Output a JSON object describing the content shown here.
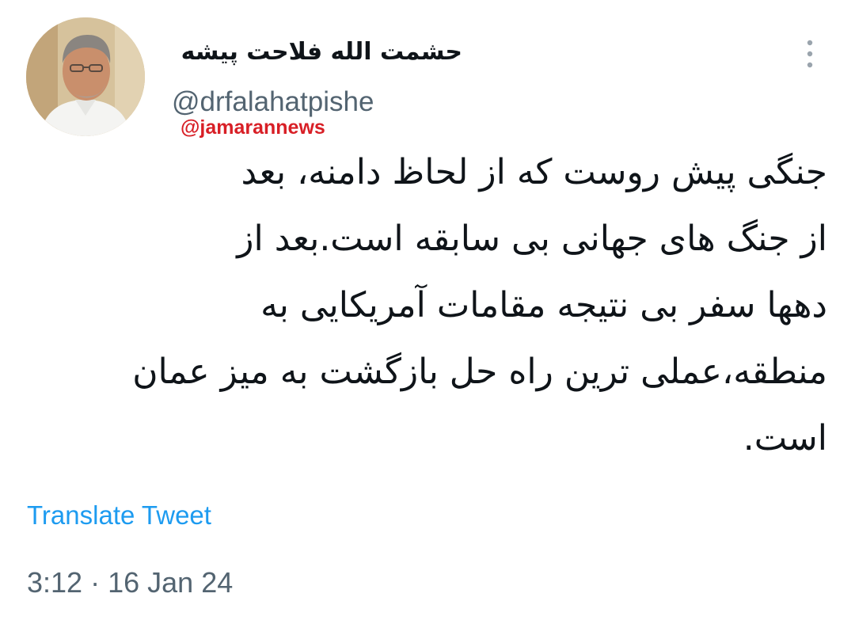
{
  "author": {
    "display_name": "حشمت الله فلاحت پیشه",
    "handle": "@drfalahatpishe"
  },
  "watermark": "@jamarannews",
  "tweet": {
    "lines": [
      "جنگی پیش روست که از لحاظ دامنه، بعد",
      "از جنگ های جهانی بی سابقه است.بعد از",
      "دهها سفر بی نتیجه مقامات آمریکایی به",
      "منطقه،عملی ترین راه حل بازگشت به میز عمان",
      "است."
    ]
  },
  "actions": {
    "translate_label": "Translate Tweet",
    "more_icon": "more-vertical-icon"
  },
  "meta": {
    "time": "3:12",
    "separator": "·",
    "date": "16 Jan 24"
  },
  "colors": {
    "link": "#1d9bf0",
    "secondary_text": "#536471",
    "primary_text": "#0f1419",
    "watermark": "#d81f26"
  }
}
